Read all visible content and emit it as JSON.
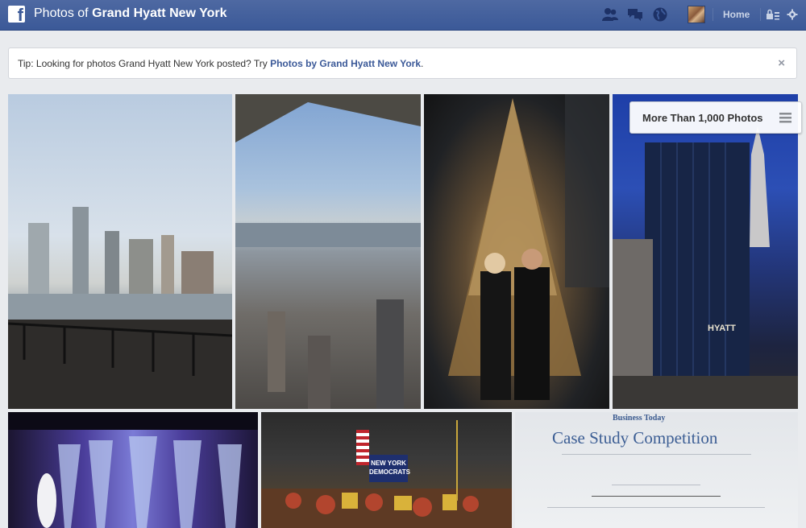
{
  "header": {
    "title_prefix": "Photos of",
    "title_page": "Grand Hyatt New York",
    "home_label": "Home",
    "icons": [
      "friend-requests-icon",
      "messages-icon",
      "notifications-globe-icon",
      "privacy-lock-icon",
      "settings-gear-icon"
    ]
  },
  "tip": {
    "text": "Tip: Looking for photos Grand Hyatt New York posted? Try",
    "link": "Photos by Grand Hyatt New York",
    "suffix": ".",
    "close": "×"
  },
  "photos": {
    "more_label": "More Than 1,000 Photos"
  },
  "photo_text": {
    "certificate_brand": "Business Today",
    "certificate_title": "Case Study Competition",
    "banner": "NEW YORK DEMOCRATS"
  },
  "colors": {
    "brand_blue": "#3b5998",
    "background": "#e9ebee",
    "link": "#3b5998"
  }
}
